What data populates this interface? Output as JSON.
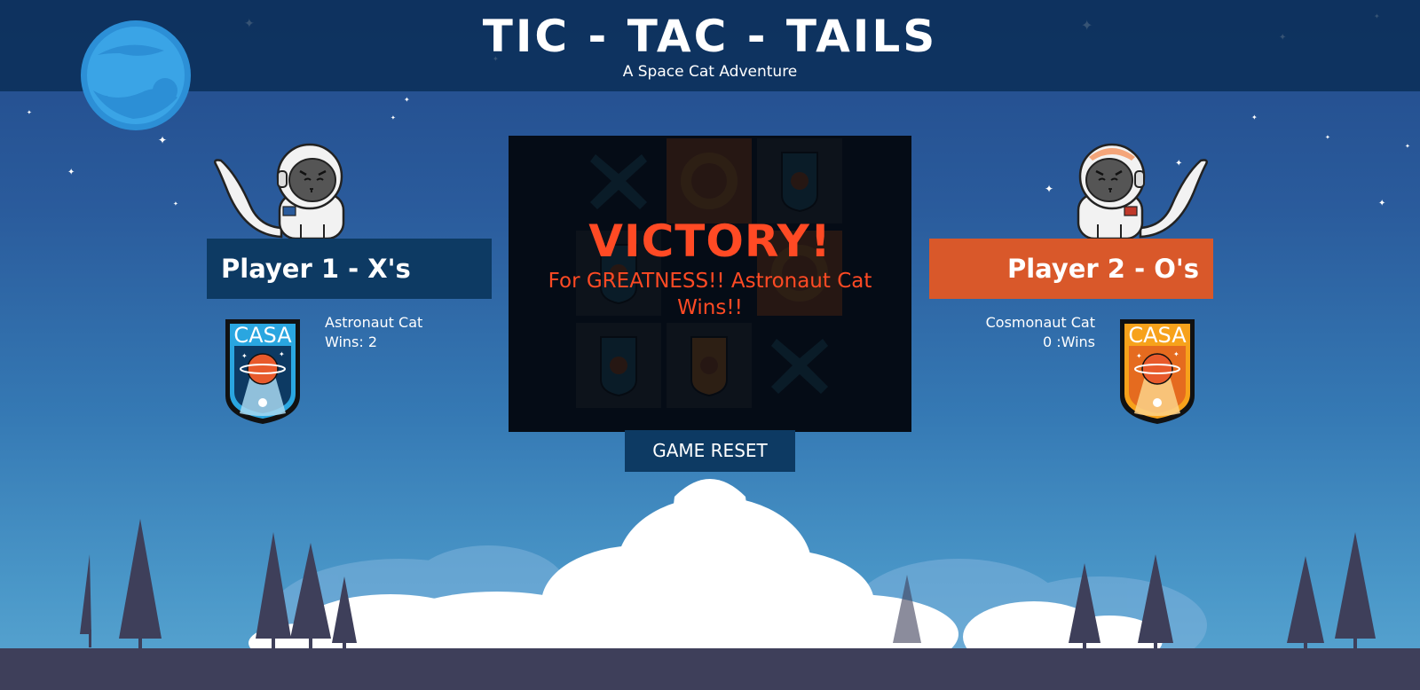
{
  "header": {
    "title": "TIC - TAC - TAILS",
    "subtitle": "A Space Cat Adventure"
  },
  "player1": {
    "label": "Player 1 - X's",
    "name": "Astronaut Cat",
    "wins_text": "Wins: 2",
    "wins": 2,
    "badge_text": "CASA",
    "color": "#0d3a63"
  },
  "player2": {
    "label": "Player 2 - O's",
    "name": "Cosmonaut Cat",
    "wins_text": "0 :Wins",
    "wins": 0,
    "badge_text": "CASA",
    "color": "#d9582a"
  },
  "board": {
    "cells": [
      "X",
      "O",
      "badge",
      "badge",
      "",
      "O",
      "badge",
      "badge",
      "X"
    ]
  },
  "victory": {
    "title": "VICTORY!",
    "message": "For GREATNESS!! Astronaut Cat Wins!!"
  },
  "controls": {
    "reset_label": "GAME RESET"
  },
  "colors": {
    "accent_orange": "#d9582a",
    "navy": "#0d3a63",
    "victory_red": "#ff4a24"
  }
}
